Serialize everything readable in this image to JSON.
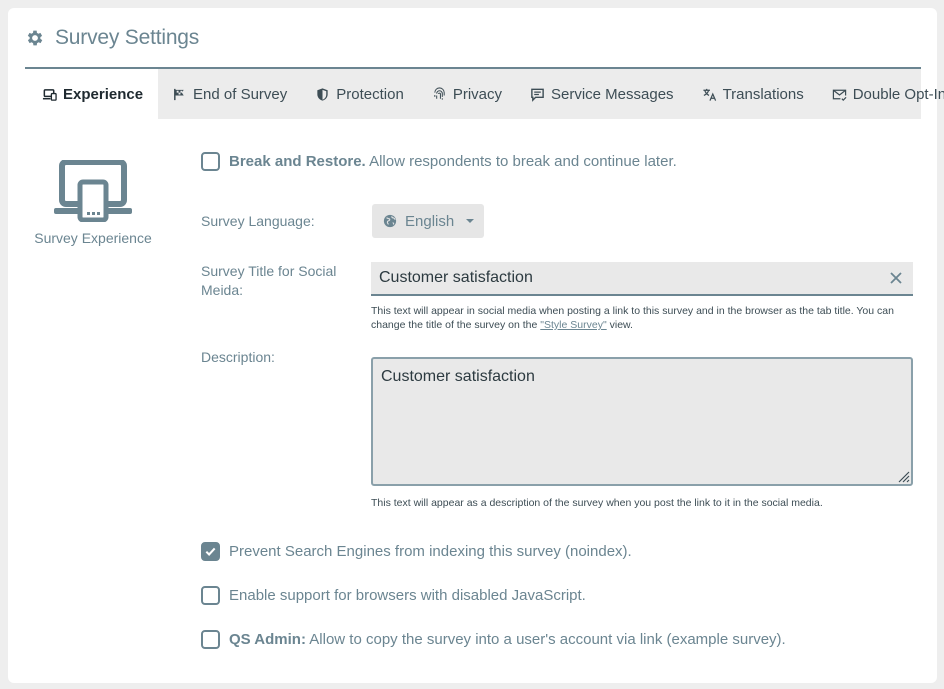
{
  "header": {
    "title": "Survey Settings",
    "icon": "gear-icon"
  },
  "tabs": [
    {
      "label": "Experience",
      "icon": "laptop-icon",
      "active": true
    },
    {
      "label": "End of Survey",
      "icon": "flag-icon",
      "active": false
    },
    {
      "label": "Protection",
      "icon": "shield-icon",
      "active": false
    },
    {
      "label": "Privacy",
      "icon": "fingerprint-icon",
      "active": false
    },
    {
      "label": "Service Messages",
      "icon": "message-icon",
      "active": false
    },
    {
      "label": "Translations",
      "icon": "translate-icon",
      "active": false
    },
    {
      "label": "Double Opt-In",
      "icon": "mail-check-icon",
      "active": false
    }
  ],
  "sidebar": {
    "label": "Survey Experience",
    "icon": "laptop-tablet-icon"
  },
  "break_restore": {
    "checked": false,
    "bold": "Break and Restore.",
    "text": "Allow respondents to break and continue later."
  },
  "language": {
    "label": "Survey Language:",
    "value": "English"
  },
  "social_title": {
    "label_line1": "Survey Title for Social",
    "label_line2": "Meida:",
    "value": "Customer satisfaction",
    "help_line1": "This text will appear in social media when posting a link to this survey and in the browser as the tab title. You can",
    "help_line2_before": "change the title of the survey on the ",
    "help_link": "\"Style Survey\"",
    "help_line2_after": " view."
  },
  "description": {
    "label": "Description:",
    "value": "Customer satisfaction",
    "help": "This text will appear as a description of the survey when you post the link to it in the social media."
  },
  "noindex": {
    "checked": true,
    "text": "Prevent Search Engines from indexing this survey (noindex)."
  },
  "nojs": {
    "checked": false,
    "text": "Enable support for browsers with disabled JavaScript."
  },
  "qs_admin": {
    "checked": false,
    "bold": "QS Admin:",
    "text": "Allow to copy the survey into a user's account via link (example survey)."
  },
  "colors": {
    "accent": "#6b8591",
    "tab_bar": "#ececec",
    "input_bg": "#e9e9e9"
  }
}
